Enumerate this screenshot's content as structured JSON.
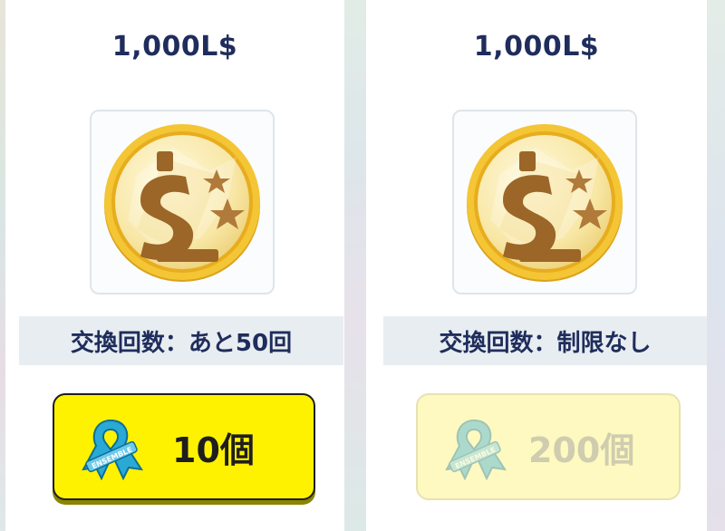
{
  "items": [
    {
      "price": "1,000L$",
      "icon": "coin-dollar-icon",
      "exchange_count": "交換回数：あと50回",
      "cost": "10個",
      "cost_icon": "ensemble-ribbon-icon",
      "state": "active"
    },
    {
      "price": "1,000L$",
      "icon": "coin-dollar-icon",
      "exchange_count": "交換回数：制限なし",
      "cost": "200個",
      "cost_icon": "ensemble-ribbon-icon",
      "state": "disabled"
    }
  ],
  "colors": {
    "text_navy": "#1f2d5c",
    "button_yellow": "#fff200",
    "button_disabled": "#fdf8b6",
    "coin_gold": "#f2c230",
    "ribbon_blue": "#2aa9d6"
  }
}
